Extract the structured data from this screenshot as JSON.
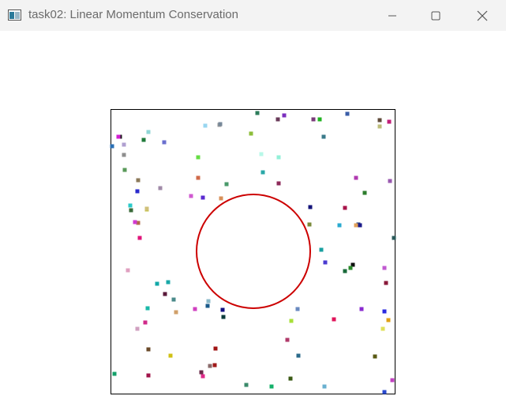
{
  "window": {
    "title": "task02: Linear Momentum Conservation",
    "icon": "app-window-icon",
    "controls": {
      "minimize": "minimize-icon",
      "maximize": "maximize-icon",
      "close": "close-icon"
    }
  },
  "simulation": {
    "border_color": "#000000",
    "circle_color": "#cc0000",
    "particles": [
      {
        "c": "#2e7d5b"
      },
      {
        "c": "#7b2fbe"
      },
      {
        "c": "#6a3b5a"
      },
      {
        "c": "#3b5ea8"
      },
      {
        "c": "#7a3b7a"
      },
      {
        "c": "#21b321"
      },
      {
        "c": "#5f4a3a"
      },
      {
        "c": "#c21f79"
      },
      {
        "c": "#bdbd7a"
      },
      {
        "c": "#1a1a1a"
      },
      {
        "c": "#8fd6d6"
      },
      {
        "c": "#9a9a9a"
      },
      {
        "c": "#98d6f0"
      },
      {
        "c": "#778899"
      },
      {
        "c": "#3a7a8a"
      },
      {
        "c": "#b0a0d0"
      },
      {
        "c": "#1f7a3a"
      },
      {
        "c": "#6a6fce"
      },
      {
        "c": "#8dbe3a"
      },
      {
        "c": "#d21fd2"
      },
      {
        "c": "#2a6fb4"
      },
      {
        "c": "#8e8e8e"
      },
      {
        "c": "#5a9a5a"
      },
      {
        "c": "#66dd44"
      },
      {
        "c": "#b8f8e8"
      },
      {
        "c": "#93f0d8"
      },
      {
        "c": "#c0c03a"
      },
      {
        "c": "#2e7d2e"
      },
      {
        "c": "#8c7a5a"
      },
      {
        "c": "#2aa8a8"
      },
      {
        "c": "#d06a4a"
      },
      {
        "c": "#4a9a6a"
      },
      {
        "c": "#8d2a5a"
      },
      {
        "c": "#b03ab0"
      },
      {
        "c": "#9a5ab0"
      },
      {
        "c": "#2a2acc"
      },
      {
        "c": "#a08aa8"
      },
      {
        "c": "#d05ad0"
      },
      {
        "c": "#5a2ad0"
      },
      {
        "c": "#d8905a"
      },
      {
        "c": "#3a6a3a"
      },
      {
        "c": "#b06a4a"
      },
      {
        "c": "#2acaca"
      },
      {
        "c": "#d0c07a"
      },
      {
        "c": "#14147a"
      },
      {
        "c": "#a8144a"
      },
      {
        "c": "#1a3a7a"
      },
      {
        "c": "#d03ad0"
      },
      {
        "c": "#e0a05a"
      },
      {
        "c": "#2aaad0"
      },
      {
        "c": "#1a1a8a"
      },
      {
        "c": "#2a5a5a"
      },
      {
        "c": "#e0147a"
      },
      {
        "c": "#7a8a3a"
      },
      {
        "c": "#18a0a0"
      },
      {
        "c": "#4a3ad0"
      },
      {
        "c": "#101010"
      },
      {
        "c": "#2a8a2a"
      },
      {
        "c": "#1a6a3a"
      },
      {
        "c": "#c05ad0"
      },
      {
        "c": "#e0a0c0"
      },
      {
        "c": "#12a8a8"
      },
      {
        "c": "#8a1a3a"
      },
      {
        "c": "#1aa8a8"
      },
      {
        "c": "#5a1a3a"
      },
      {
        "c": "#4a8a8a"
      },
      {
        "c": "#d040c0"
      },
      {
        "c": "#8ab8c8"
      },
      {
        "c": "#d0a06a"
      },
      {
        "c": "#101080"
      },
      {
        "c": "#0a3a3a"
      },
      {
        "c": "#1ab8a8"
      },
      {
        "c": "#6a8ac0"
      },
      {
        "c": "#8a2ad0"
      },
      {
        "c": "#2a2ae0"
      },
      {
        "c": "#e0145a"
      },
      {
        "c": "#a8e03a"
      },
      {
        "c": "#d02a8a"
      },
      {
        "c": "#e0a014"
      },
      {
        "c": "#d0a0c0"
      },
      {
        "c": "#e0e05a"
      },
      {
        "c": "#6a4a2a"
      },
      {
        "c": "#b03a6a"
      },
      {
        "c": "#a01414"
      },
      {
        "c": "#d0c014"
      },
      {
        "c": "#2a6a8a"
      },
      {
        "c": "#5a5a14"
      },
      {
        "c": "#14a06a"
      },
      {
        "c": "#a0144a"
      },
      {
        "c": "#a01a1a"
      },
      {
        "c": "#6a2a4a"
      },
      {
        "c": "#e02a8a"
      },
      {
        "c": "#6ab0d0"
      },
      {
        "c": "#3a8a6a"
      },
      {
        "c": "#14b06a"
      },
      {
        "c": "#3a5a14"
      },
      {
        "c": "#c040c0"
      },
      {
        "c": "#8a6a6a"
      },
      {
        "c": "#2a4ad0"
      },
      {
        "c": "#1a5a8a"
      }
    ]
  }
}
